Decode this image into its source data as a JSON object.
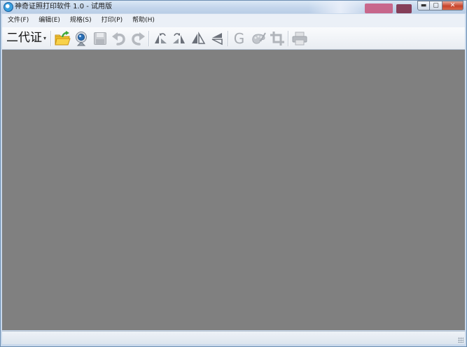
{
  "window": {
    "title": "神奇证照打印软件 1.0 - 试用版",
    "controls": {
      "minimize": "▬",
      "maximize": "▢",
      "close": "✕"
    }
  },
  "menubar": {
    "items": [
      {
        "label": "文件(F)"
      },
      {
        "label": "编辑(E)"
      },
      {
        "label": "规格(S)"
      },
      {
        "label": "打印(P)"
      },
      {
        "label": "帮助(H)"
      }
    ]
  },
  "toolbar": {
    "card_type": "二代证",
    "card_type_arrow": "▾",
    "buttons": [
      {
        "icon": "open-folder-icon",
        "enabled": true
      },
      {
        "icon": "webcam-icon",
        "enabled": true
      },
      {
        "icon": "save-icon",
        "enabled": false
      },
      {
        "icon": "undo-icon",
        "enabled": false
      },
      {
        "icon": "redo-icon",
        "enabled": false
      },
      {
        "icon": "rotate-left-icon",
        "enabled": true
      },
      {
        "icon": "rotate-right-icon",
        "enabled": true
      },
      {
        "icon": "flip-horizontal-icon",
        "enabled": true
      },
      {
        "icon": "flip-vertical-icon",
        "enabled": true
      },
      {
        "icon": "grayscale-icon",
        "enabled": false,
        "glyph": "G"
      },
      {
        "icon": "palette-icon",
        "enabled": false
      },
      {
        "icon": "crop-icon",
        "enabled": false
      },
      {
        "icon": "print-icon",
        "enabled": false
      }
    ]
  },
  "colors": {
    "canvas": "#808080",
    "titlebar": "#c4d6ec",
    "toolbar_disabled": "#a9adb3",
    "folder": "#f2c12e",
    "folder_arrow": "#3ea83a",
    "webcam_lens": "#2a6fb6"
  }
}
